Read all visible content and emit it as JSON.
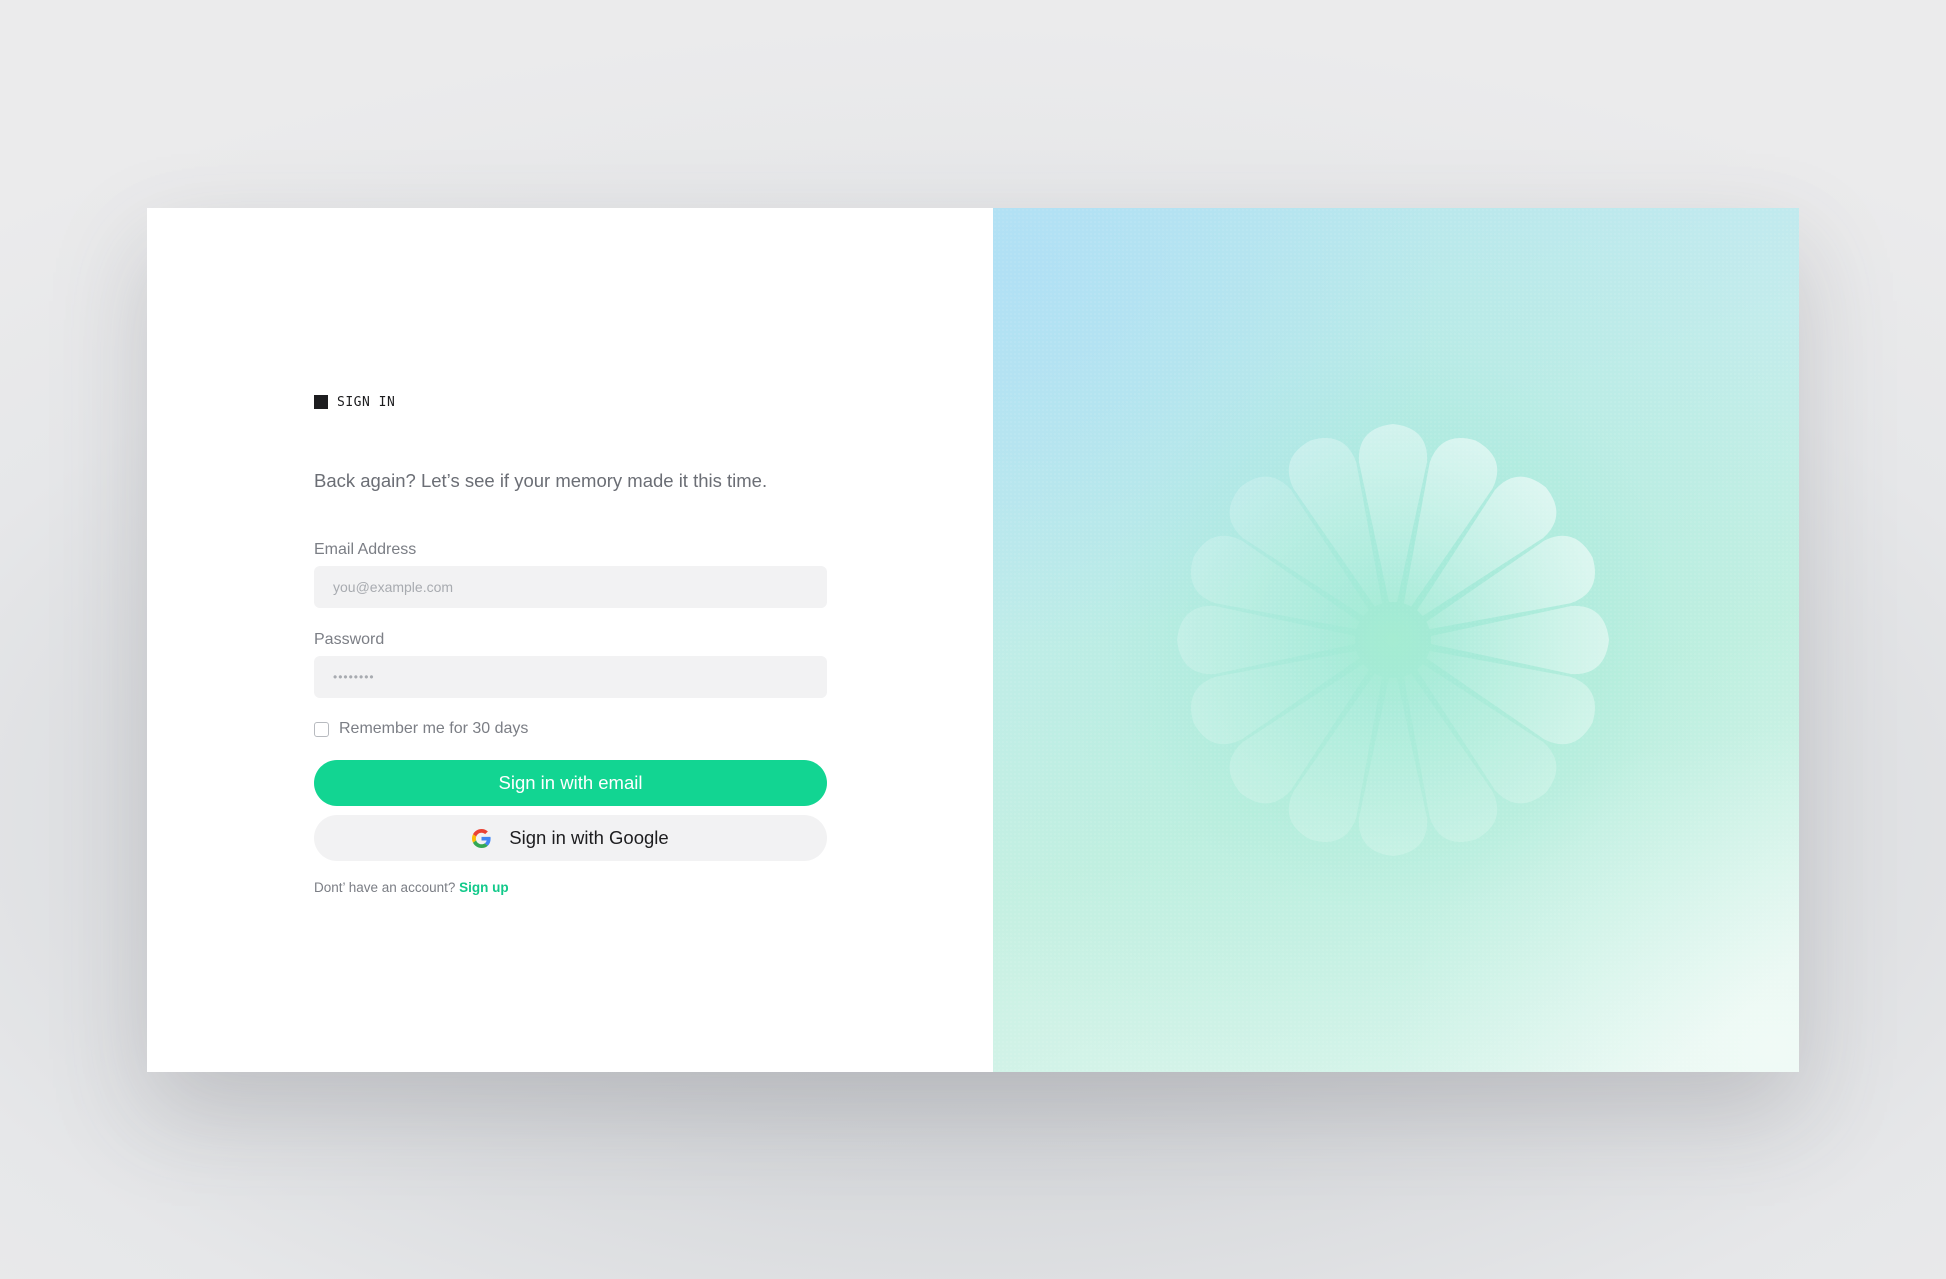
{
  "eyebrow": "SIGN IN",
  "subtitle": "Back again? Let’s see if your memory made it this time.",
  "email": {
    "label": "Email Address",
    "placeholder": "you@example.com"
  },
  "password": {
    "label": "Password",
    "placeholder": "••••••••"
  },
  "remember": {
    "label": "Remember me for 30 days",
    "checked": false
  },
  "buttons": {
    "email": "Sign in with email",
    "google": "Sign in with Google"
  },
  "signup": {
    "prompt": "Dont’ have an account?",
    "link": "Sign up"
  },
  "icons": {
    "google": "google-icon",
    "eyebrow": "square-icon",
    "illustration": "flower-burst-icon"
  },
  "colors": {
    "accent": "#12d592",
    "text_primary": "#1d1d1f",
    "text_secondary": "#7b7e85",
    "input_bg": "#f2f2f3"
  }
}
